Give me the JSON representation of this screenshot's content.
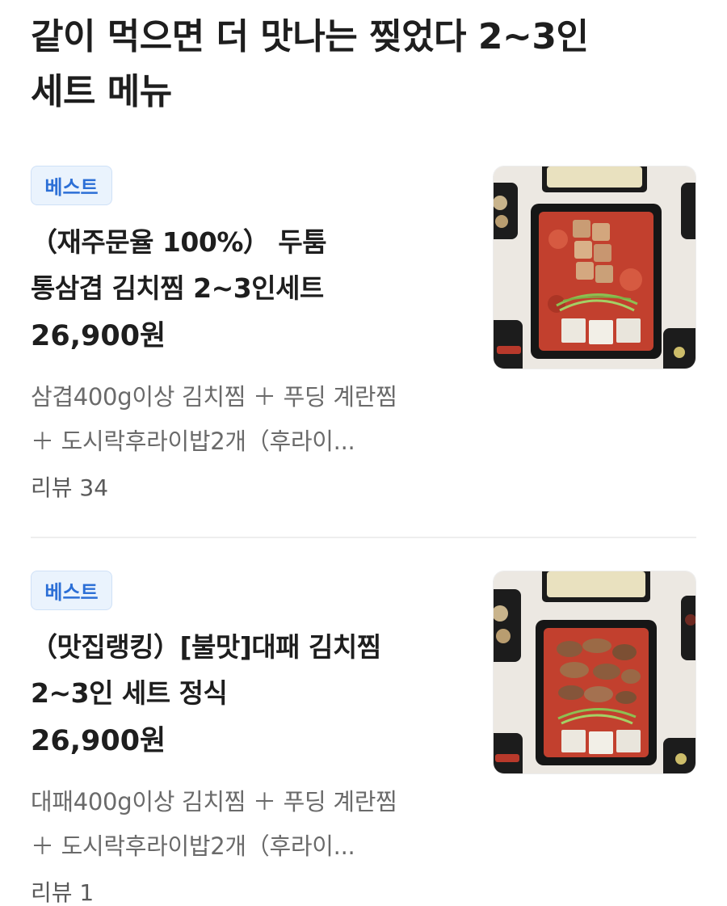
{
  "section": {
    "title_line1": "같이 먹으면 더 맛나는 찢었다 2~3인",
    "title_line2": "세트 메뉴"
  },
  "items": [
    {
      "badge": "베스트",
      "name_line1": "（재주문율 100%） 두툼",
      "name_line2": "통삼겹 김치찜 2~3인세트",
      "price": "26,900원",
      "desc_line1": "삼겹400g이상 김치찜 ＋ 푸딩 계란찜",
      "desc_line2": "＋ 도시락후라이밥2개（후라이...",
      "review": "리뷰 34",
      "image_icon": "kimchi-jjim-pork-belly-photo"
    },
    {
      "badge": "베스트",
      "name_line1": "（맛집랭킹）[불맛]대패 김치찜",
      "name_line2": "2~3인 세트 정식",
      "price": "26,900원",
      "desc_line1": "대패400g이상 김치찜 ＋ 푸딩 계란찜",
      "desc_line2": "＋ 도시락후라이밥2개（후라이...",
      "review": "리뷰 1",
      "image_icon": "kimchi-jjim-sliced-pork-photo"
    }
  ],
  "colors": {
    "badge_bg": "#eaf3fd",
    "badge_text": "#2c6fd6",
    "title_text": "#1e1e1e",
    "desc_text": "#6a6a6a"
  }
}
